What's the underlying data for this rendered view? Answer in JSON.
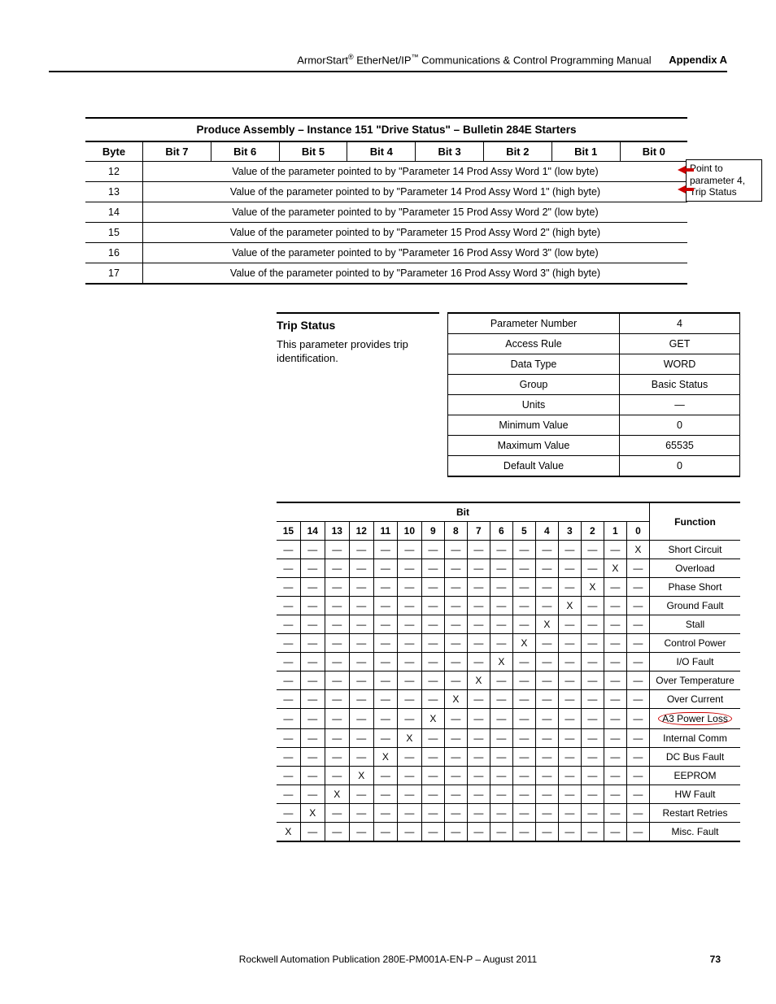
{
  "header": {
    "product": "ArmorStart",
    "reg": "®",
    "proto": " EtherNet/IP",
    "tm": "™",
    "rest": " Communications & Control Programming Manual",
    "appendix": "Appendix A"
  },
  "table1": {
    "caption": "Produce Assembly – Instance 151 \"Drive Status\" – Bulletin 284E Starters",
    "headers": [
      "Byte",
      "Bit 7",
      "Bit 6",
      "Bit 5",
      "Bit 4",
      "Bit 3",
      "Bit 2",
      "Bit 1",
      "Bit 0"
    ],
    "rows": [
      {
        "byte": "12",
        "desc": "Value of the parameter pointed to by \"Parameter 14 Prod Assy Word 1\" (low byte)"
      },
      {
        "byte": "13",
        "desc": "Value of the parameter pointed to by \"Parameter 14 Prod Assy Word 1\" (high byte)"
      },
      {
        "byte": "14",
        "desc": "Value of the parameter pointed to by \"Parameter 15 Prod Assy Word 2\" (low byte)"
      },
      {
        "byte": "15",
        "desc": "Value of the parameter pointed to by \"Parameter 15 Prod Assy Word 2\" (high byte)"
      },
      {
        "byte": "16",
        "desc": "Value of the parameter pointed to by \"Parameter 16 Prod Assy Word 3\" (low byte)"
      },
      {
        "byte": "17",
        "desc": "Value of the parameter pointed to by \"Parameter 16 Prod Assy Word 3\" (high byte)"
      }
    ],
    "callout": "Point to parameter 4, Trip Status"
  },
  "table2": {
    "title": "Trip Status",
    "desc": "This parameter provides trip identification.",
    "rows": [
      [
        "Parameter Number",
        "4"
      ],
      [
        "Access Rule",
        "GET"
      ],
      [
        "Data Type",
        "WORD"
      ],
      [
        "Group",
        "Basic Status"
      ],
      [
        "Units",
        "—"
      ],
      [
        "Minimum Value",
        "0"
      ],
      [
        "Maximum Value",
        "65535"
      ],
      [
        "Default Value",
        "0"
      ]
    ]
  },
  "table3": {
    "bit_label": "Bit",
    "func_label": "Function",
    "bits": [
      "15",
      "14",
      "13",
      "12",
      "11",
      "10",
      "9",
      "8",
      "7",
      "6",
      "5",
      "4",
      "3",
      "2",
      "1",
      "0"
    ],
    "rows": [
      {
        "set": 0,
        "func": "Short Circuit"
      },
      {
        "set": 1,
        "func": "Overload"
      },
      {
        "set": 2,
        "func": "Phase Short"
      },
      {
        "set": 3,
        "func": "Ground Fault"
      },
      {
        "set": 4,
        "func": "Stall"
      },
      {
        "set": 5,
        "func": "Control Power"
      },
      {
        "set": 6,
        "func": "I/O Fault"
      },
      {
        "set": 7,
        "func": "Over Temperature"
      },
      {
        "set": 8,
        "func": "Over Current"
      },
      {
        "set": 9,
        "func": "A3 Power Loss",
        "circled": true
      },
      {
        "set": 10,
        "func": "Internal Comm"
      },
      {
        "set": 11,
        "func": "DC Bus Fault"
      },
      {
        "set": 12,
        "func": "EEPROM"
      },
      {
        "set": 13,
        "func": "HW Fault"
      },
      {
        "set": 14,
        "func": "Restart Retries"
      },
      {
        "set": 15,
        "func": "Misc. Fault"
      }
    ]
  },
  "footer": {
    "text": "Rockwell Automation Publication 280E-PM001A-EN-P – August 2011",
    "page": "73"
  }
}
